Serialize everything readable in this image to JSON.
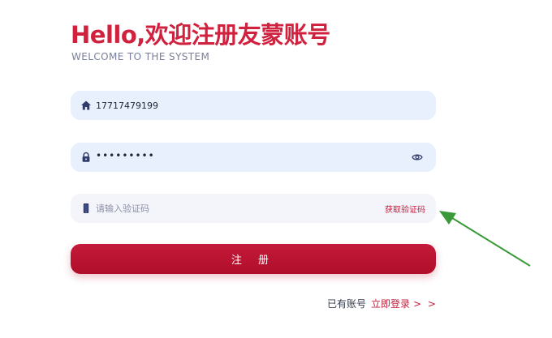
{
  "header": {
    "title": "Hello,欢迎注册友蒙账号",
    "subtitle": "WELCOME TO THE SYSTEM"
  },
  "form": {
    "username": {
      "value": "17717479199",
      "icon": "home-icon"
    },
    "password": {
      "value": "•••••••••",
      "icon": "lock-icon",
      "toggle_icon": "eye-icon"
    },
    "code": {
      "placeholder": "请输入验证码",
      "icon": "phone-icon",
      "get_code_label": "获取验证码"
    },
    "submit_label": "注 册"
  },
  "footer": {
    "question": "已有账号",
    "login_link": "立即登录",
    "arrows": "> >"
  },
  "colors": {
    "brand_red": "#d0213f",
    "button_red": "#b00f2b",
    "input_bg": "#e9f0fd",
    "icon_navy": "#2f3b6b",
    "annotation_green": "#3a9a3a"
  }
}
